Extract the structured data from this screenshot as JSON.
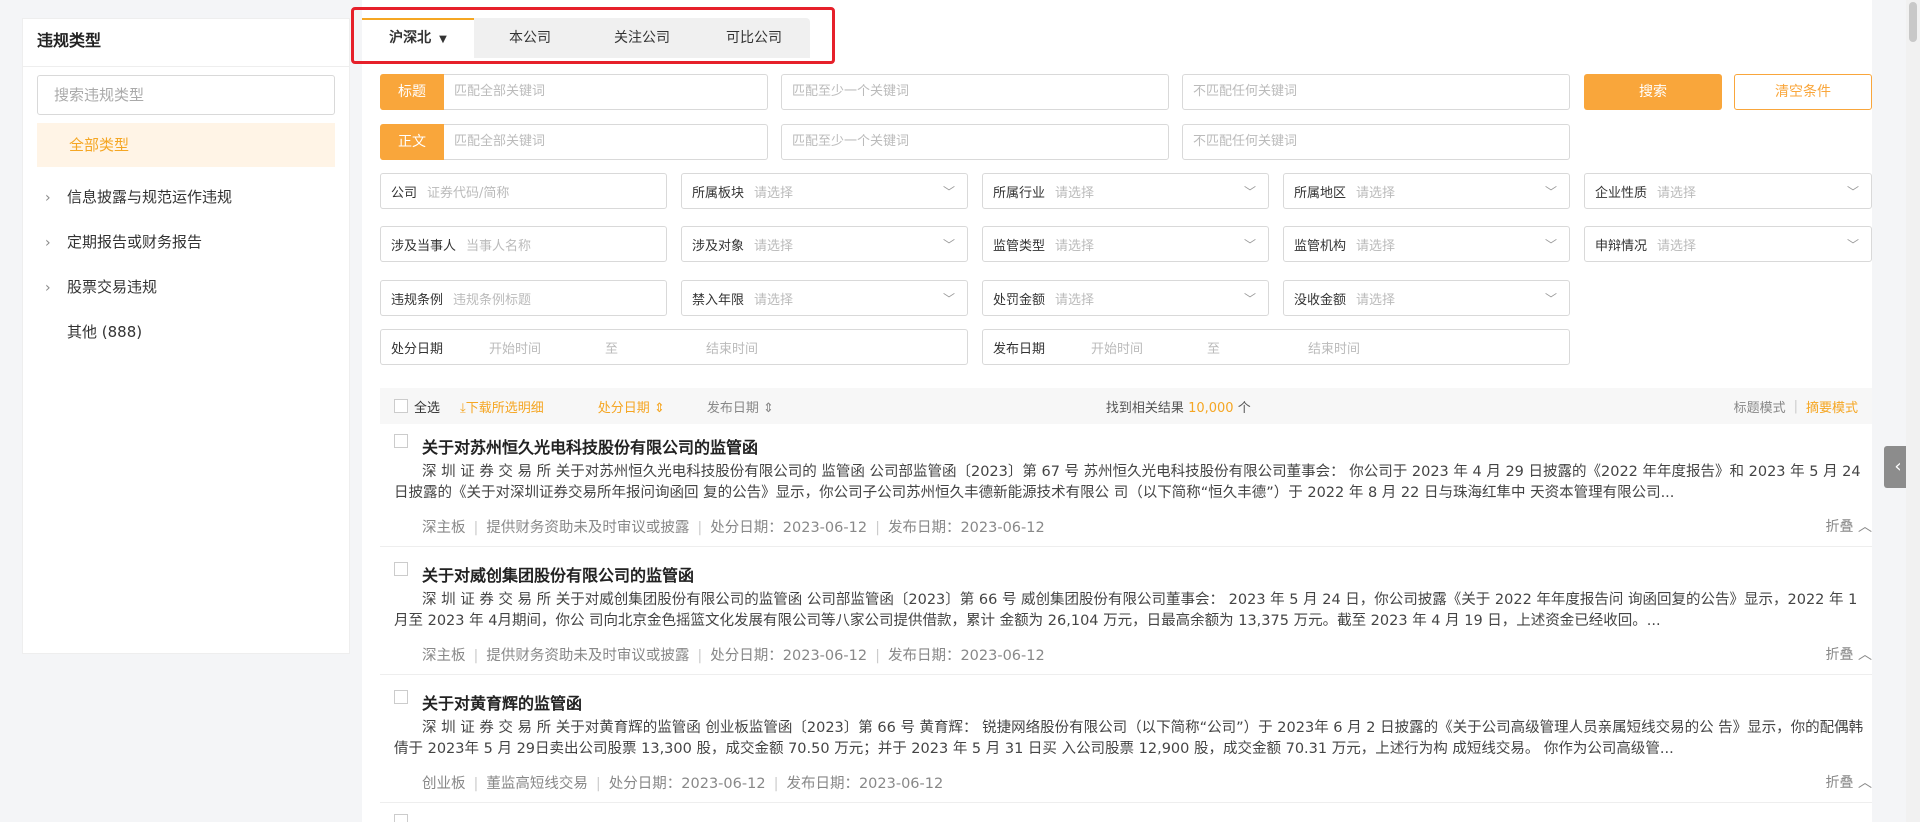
{
  "sidebar": {
    "title": "违规类型",
    "search_placeholder": "搜索违规类型",
    "all_label": "全部类型",
    "items": [
      {
        "label": "信息披露与规范运作违规",
        "expandable": true
      },
      {
        "label": "定期报告或财务报告",
        "expandable": true
      },
      {
        "label": "股票交易违规",
        "expandable": true
      },
      {
        "label": "其他 (888)",
        "expandable": false
      }
    ]
  },
  "tabs": [
    {
      "label": "沪深北",
      "active": true
    },
    {
      "label": "本公司",
      "active": false
    },
    {
      "label": "关注公司",
      "active": false
    },
    {
      "label": "可比公司",
      "active": false
    }
  ],
  "keyword_rows": [
    {
      "label": "标题",
      "all_placeholder": "匹配全部关键词",
      "any_placeholder": "匹配至少一个关键词",
      "none_placeholder": "不匹配任何关键词"
    },
    {
      "label": "正文",
      "all_placeholder": "匹配全部关键词",
      "any_placeholder": "匹配至少一个关键词",
      "none_placeholder": "不匹配任何关键词"
    }
  ],
  "buttons": {
    "search": "搜索",
    "clear": "清空条件"
  },
  "filters": {
    "company": {
      "label": "公司",
      "placeholder": "证券代码/简称"
    },
    "board": {
      "label": "所属板块",
      "placeholder": "请选择"
    },
    "industry": {
      "label": "所属行业",
      "placeholder": "请选择"
    },
    "region": {
      "label": "所属地区",
      "placeholder": "请选择"
    },
    "nature": {
      "label": "企业性质",
      "placeholder": "请选择"
    },
    "party": {
      "label": "涉及当事人",
      "placeholder": "当事人名称"
    },
    "target": {
      "label": "涉及对象",
      "placeholder": "请选择"
    },
    "supervision_type": {
      "label": "监管类型",
      "placeholder": "请选择"
    },
    "agency": {
      "label": "监管机构",
      "placeholder": "请选择"
    },
    "appeal": {
      "label": "申辩情况",
      "placeholder": "请选择"
    },
    "clause": {
      "label": "违规条例",
      "placeholder": "违规条例标题"
    },
    "ban_years": {
      "label": "禁入年限",
      "placeholder": "请选择"
    },
    "penalty_amount": {
      "label": "处罚金额",
      "placeholder": "请选择"
    },
    "confiscation": {
      "label": "没收金额",
      "placeholder": "请选择"
    },
    "penalty_date": {
      "label": "处分日期",
      "start": "开始时间",
      "to": "至",
      "end": "结束时间"
    },
    "publish_date": {
      "label": "发布日期",
      "start": "开始时间",
      "to": "至",
      "end": "结束时间"
    }
  },
  "list_bar": {
    "select_all": "全选",
    "download": "下载所选明细",
    "sort_penalty": "处分日期",
    "sort_publish": "发布日期",
    "result_prefix": "找到相关结果",
    "result_count": "10,000",
    "result_suffix": "个",
    "mode_title": "标题模式",
    "mode_summary": "摘要模式"
  },
  "results": [
    {
      "title": "关于对苏州恒久光电科技股份有限公司的监管函",
      "body": "深 圳 证 券 交 易 所 关于对苏州恒久光电科技股份有限公司的 监管函 公司部监管函〔2023〕第 67 号 苏州恒久光电科技股份有限公司董事会： 你公司于 2023 年 4 月 29 日披露的《2022 年年度报告》和 2023 年 5 月 24日披露的《关于对深圳证券交易所年报问询函回 复的公告》显示，你公司子公司苏州恒久丰德新能源技术有限公 司（以下简称“恒久丰德”）于 2022 年 8 月 22 日与珠海红隼中 天资本管理有限公司...",
      "board": "深主板",
      "violation": "提供财务资助未及时审议或披露",
      "penalty_date": "处分日期：2023-06-12",
      "publish_date": "发布日期：2023-06-12",
      "fold": "折叠"
    },
    {
      "title": "关于对威创集团股份有限公司的监管函",
      "body": "深 圳 证 券 交 易 所 关于对威创集团股份有限公司的监管函 公司部监管函〔2023〕第 66 号 威创集团股份有限公司董事会： 2023 年 5 月 24 日，你公司披露《关于 2022 年年度报告问 询函回复的公告》显示，2022 年 1月至 2023 年 4月期间，你公 司向北京金色摇篮文化发展有限公司等八家公司提供借款，累计 金额为 26,104 万元，日最高余额为 13,375 万元。截至 2023 年 4 月 19 日，上述资金已经收回。...",
      "board": "深主板",
      "violation": "提供财务资助未及时审议或披露",
      "penalty_date": "处分日期：2023-06-12",
      "publish_date": "发布日期：2023-06-12",
      "fold": "折叠"
    },
    {
      "title": "关于对黄育辉的监管函",
      "body": "深 圳 证 券 交 易 所 关于对黄育辉的监管函 创业板监管函〔2023〕第 66 号 黄育辉： 锐捷网络股份有限公司（以下简称“公司”）于 2023年 6 月 2 日披露的《关于公司高级管理人员亲属短线交易的公 告》显示，你的配偶韩倩于 2023年 5 月 29日卖出公司股票 13,300 股，成交金额 70.50 万元；并于 2023 年 5 月 31 日买 入公司股票 12,900 股，成交金额 70.31 万元，上述行为构 成短线交易。 你作为公司高级管...",
      "board": "创业板",
      "violation": "董监高短线交易",
      "penalty_date": "处分日期：2023-06-12",
      "publish_date": "发布日期：2023-06-12",
      "fold": "折叠"
    }
  ]
}
